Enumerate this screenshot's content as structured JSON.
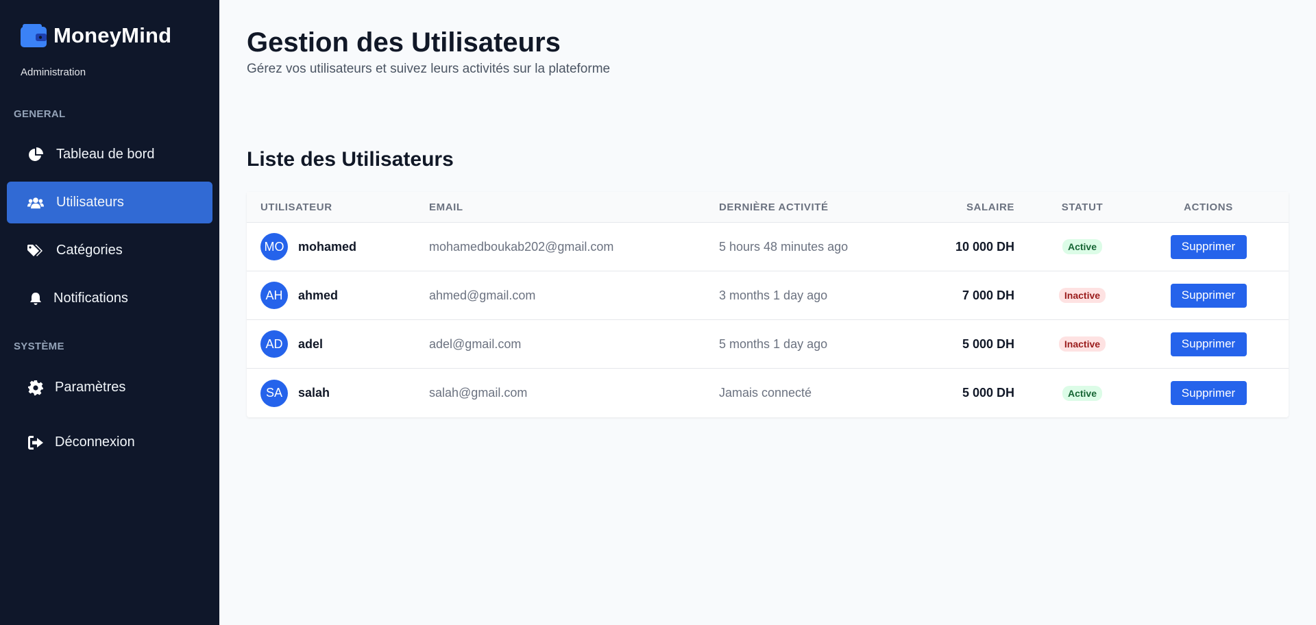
{
  "app": {
    "name": "MoneyMind",
    "subtitle": "Administration",
    "brand_color": "#3b82f6"
  },
  "sidebar": {
    "sections": [
      {
        "label": "GENERAL"
      },
      {
        "label": "SYSTÈME"
      }
    ],
    "items": [
      {
        "label": "Tableau de bord",
        "icon": "pie-chart-icon",
        "active": false
      },
      {
        "label": "Utilisateurs",
        "icon": "users-icon",
        "active": true
      },
      {
        "label": "Catégories",
        "icon": "tags-icon",
        "active": false
      },
      {
        "label": "Notifications",
        "icon": "bell-icon",
        "active": false
      },
      {
        "label": "Paramètres",
        "icon": "gear-icon",
        "active": false
      },
      {
        "label": "Déconnexion",
        "icon": "sign-out-icon",
        "active": false
      }
    ]
  },
  "header": {
    "title": "Gestion des Utilisateurs",
    "subtitle": "Gérez vos utilisateurs et suivez leurs activités sur la plateforme"
  },
  "users_table": {
    "title": "Liste des Utilisateurs",
    "columns": [
      "UTILISATEUR",
      "EMAIL",
      "DERNIÈRE ACTIVITÉ",
      "SALAIRE",
      "STATUT",
      "ACTIONS"
    ],
    "rows": [
      {
        "initials": "MO",
        "name": "mohamed",
        "email": "mohamedboukab202@gmail.com",
        "activity": "5 hours 48 minutes ago",
        "salary": "10 000 DH",
        "status": "Active",
        "action": "Supprimer"
      },
      {
        "initials": "AH",
        "name": "ahmed",
        "email": "ahmed@gmail.com",
        "activity": "3 months 1 day ago",
        "salary": "7 000 DH",
        "status": "Inactive",
        "action": "Supprimer"
      },
      {
        "initials": "AD",
        "name": "adel",
        "email": "adel@gmail.com",
        "activity": "5 months 1 day ago",
        "salary": "5 000 DH",
        "status": "Inactive",
        "action": "Supprimer"
      },
      {
        "initials": "SA",
        "name": "salah",
        "email": "salah@gmail.com",
        "activity": "Jamais connecté",
        "salary": "5 000 DH",
        "status": "Active",
        "action": "Supprimer"
      }
    ]
  }
}
